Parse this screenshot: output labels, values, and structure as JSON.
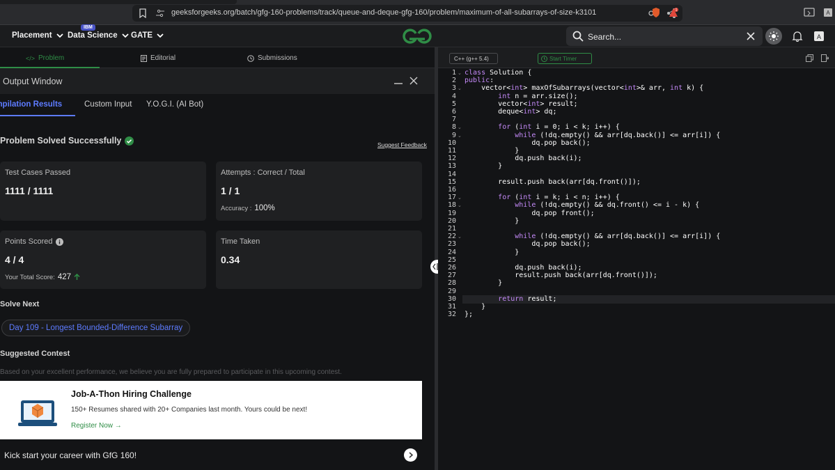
{
  "browser": {
    "url": "geeksforgeeks.org/batch/gfg-160-problems/track/queue-and-deque-gfg-160/problem/maximum-of-all-subarrays-of-size-k3101",
    "alert_count": "1"
  },
  "nav": {
    "placement": "Placement",
    "data_science": "Data Science",
    "ibm_badge": "IBM",
    "gate": "GATE",
    "search_placeholder": "Search..."
  },
  "left_tabs": [
    "Problem",
    "Editorial",
    "Submissions"
  ],
  "output": {
    "title": "Output Window",
    "subtabs": [
      "Compilation Results",
      "Custom Input",
      "Y.O.G.I. (AI Bot)"
    ],
    "solved_text": "Problem Solved Successfully",
    "feedback": "Suggest Feedback",
    "cards": {
      "tests_label": "Test Cases Passed",
      "tests_val": "1111 / 1111",
      "attempts_label": "Attempts : Correct / Total",
      "attempts_val": "1 / 1",
      "accuracy_label": "Accuracy :",
      "accuracy_val": "100%",
      "points_label": "Points Scored",
      "points_val": "4 / 4",
      "total_label": "Your Total Score:",
      "total_val": "427",
      "time_label": "Time Taken",
      "time_val": "0.34"
    },
    "solve_next_label": "Solve Next",
    "solve_next_item": "Day 109 - Longest Bounded-Difference Subarray",
    "contest_label": "Suggested Contest",
    "contest_note": "Based on your excellent performance, we believe you are fully prepared to participate in this upcoming contest.",
    "contest_title": "Job-A-Thon Hiring Challenge",
    "contest_desc": "150+ Resumes shared with 20+ Companies last month. Yours could be next!",
    "contest_register": "Register Now →",
    "kick_text": "Kick start your career with GfG 160!"
  },
  "editor": {
    "language": "C++ (g++ 5.4)",
    "timer": "Start Timer",
    "lines": [
      "class Solution {",
      "public:",
      "    vector<int> maxOfSubarrays(vector<int>& arr, int k) {",
      "        int n = arr.size();",
      "        vector<int> result;",
      "        deque<int> dq;",
      "",
      "        for (int i = 0; i < k; i++) {",
      "            while (!dq.empty() && arr[dq.back()] <= arr[i]) {",
      "                dq.pop back();",
      "            }",
      "            dq.push back(i);",
      "        }",
      "",
      "        result.push back(arr[dq.front()]);",
      "",
      "        for (int i = k; i < n; i++) {",
      "            while (!dq.empty() && dq.front() <= i - k) {",
      "                dq.pop front();",
      "            }",
      "",
      "            while (!dq.empty() && arr[dq.back()] <= arr[i]) {",
      "                dq.pop back();",
      "            }",
      "",
      "            dq.push back(i);",
      "            result.push back(arr[dq.front()]);",
      "        }",
      "",
      "        return result;",
      "    }",
      "};"
    ]
  },
  "colors": {
    "accent_green": "#2f8d46",
    "accent_blue": "#5d7bff"
  }
}
